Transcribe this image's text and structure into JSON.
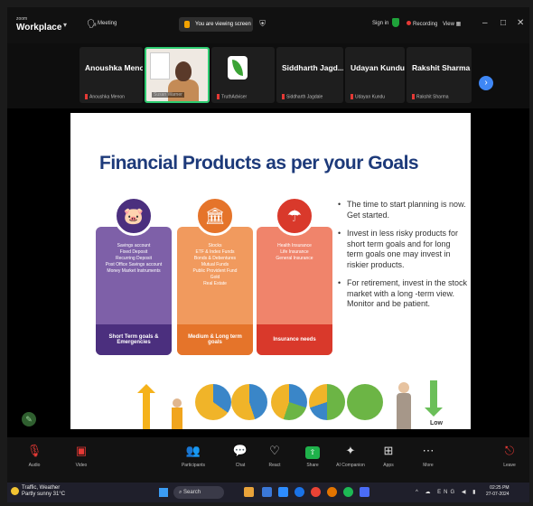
{
  "app": {
    "brand_small": "zoom",
    "brand": "Workplace",
    "meeting_label": "Meeting",
    "share_status": "You are viewing screen",
    "signin": "Sign in",
    "recording": "Recording",
    "view": "View",
    "window_controls": [
      "–",
      "□",
      "✕"
    ]
  },
  "participants": [
    {
      "name": "Anoushka Menon",
      "sub": "Anoushka Menon"
    },
    {
      "name": "",
      "sub": "Susan Warner"
    },
    {
      "name": "",
      "sub": "TruthAdviser"
    },
    {
      "name": "Siddharth Jagd...",
      "sub": "Siddharth Jagdale"
    },
    {
      "name": "Udayan Kundu",
      "sub": "Udayan Kundu"
    },
    {
      "name": "Rakshit Sharma",
      "sub": "Rakshit Sharma"
    }
  ],
  "slide": {
    "title": "Financial Products as per your Goals",
    "cards": [
      {
        "icon": "piggy-bank-icon",
        "glyph": "🐷",
        "body": "Savings account\nFixed Deposit\nRecurring Deposit\nPost Office Savings account\nMoney Market Instruments",
        "footer": "Short Term goals & Emergencies",
        "color": "#7e60a8",
        "foot_color": "#4b2f7e"
      },
      {
        "icon": "bank-icon",
        "glyph": "🏛",
        "body": "Stocks\nETF & Index Funds\nBonds & Debentures\nMutual Funds\nPublic Provident Fund\nGold\nReal Estate",
        "footer": "Medium & Long term goals",
        "color": "#f19a5e",
        "foot_color": "#e5742a"
      },
      {
        "icon": "insurance-icon",
        "glyph": "☂",
        "body": "Health Insurance\nLife Insurance\nGeneral Insurance",
        "footer": "Insurance needs",
        "color": "#f0846b",
        "foot_color": "#d9392b"
      }
    ],
    "bullets": [
      "The time to start planning is now. Get started.",
      "Invest in less risky products for short term goals and for long term goals one may invest in riskier products.",
      "For retirement, invest in the stock market with a long -term view. Monitor and be patient."
    ],
    "low_label": "Low",
    "pie_colors": [
      "#3a86c8",
      "#f0b429",
      "#6cb545"
    ]
  },
  "toolbar": [
    {
      "name": "audio",
      "label": "Audio",
      "glyph": "🎙",
      "red": true
    },
    {
      "name": "video",
      "label": "Video",
      "glyph": "▣",
      "red": true
    },
    {
      "name": "participants",
      "label": "Participants",
      "glyph": "👥",
      "red": false
    },
    {
      "name": "chat",
      "label": "Chat",
      "glyph": "💬",
      "red": false
    },
    {
      "name": "react",
      "label": "React",
      "glyph": "♡",
      "red": false
    },
    {
      "name": "share",
      "label": "Share",
      "glyph": "⇧",
      "green": true
    },
    {
      "name": "ai-companion",
      "label": "AI Companion",
      "glyph": "✦",
      "red": false
    },
    {
      "name": "apps",
      "label": "Apps",
      "glyph": "⊞",
      "red": false
    },
    {
      "name": "more",
      "label": "More",
      "glyph": "⋯",
      "red": false
    },
    {
      "name": "leave",
      "label": "Leave",
      "glyph": "⎋",
      "red": true
    }
  ],
  "taskbar": {
    "weather_line1": "Traffic, Weather",
    "weather_line2": "Partly sunny 31°C",
    "search": "Search",
    "tray": "^ ☁ ENG ◀ ▮",
    "time": "02:25 PM",
    "date": "27-07-2024"
  }
}
